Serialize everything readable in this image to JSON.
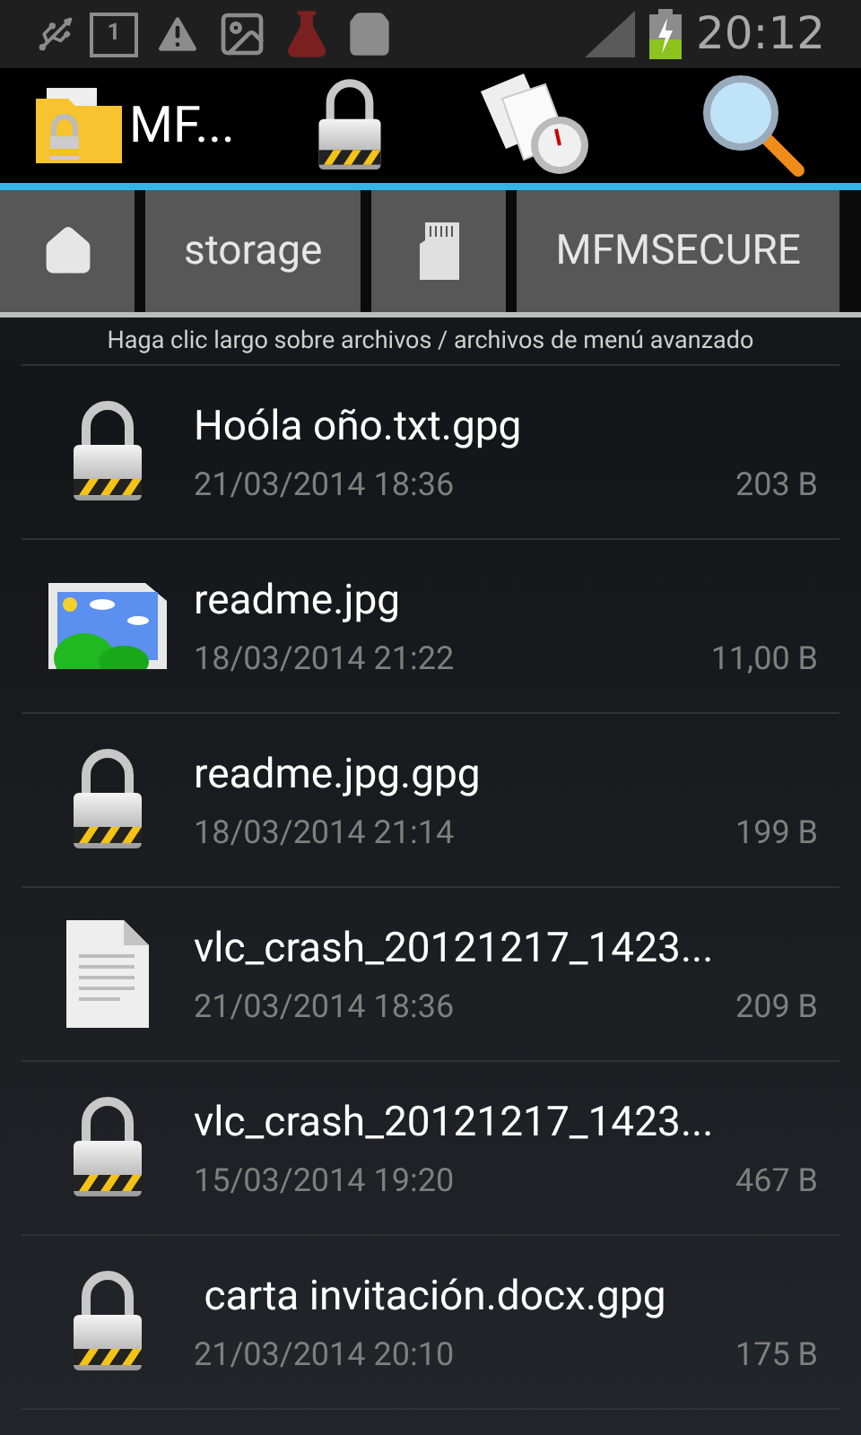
{
  "status_bar": {
    "time": "20:12",
    "calendar_day": "1"
  },
  "action_bar": {
    "title": "MF..."
  },
  "breadcrumbs": [
    {
      "kind": "home"
    },
    {
      "kind": "text",
      "label": "storage"
    },
    {
      "kind": "sdcard"
    },
    {
      "kind": "text",
      "label": "MFMSECURE"
    }
  ],
  "hint": "Haga clic largo sobre archivos / archivos de menú avanzado",
  "files": [
    {
      "kind": "locked",
      "name": "Hoóla oño.txt.gpg",
      "date": "21/03/2014 18:36",
      "size": "203 B"
    },
    {
      "kind": "image",
      "name": "readme.jpg",
      "date": "18/03/2014 21:22",
      "size": "11,00 B"
    },
    {
      "kind": "locked",
      "name": "readme.jpg.gpg",
      "date": "18/03/2014 21:14",
      "size": "199 B"
    },
    {
      "kind": "document",
      "name": "vlc_crash_20121217_1423...",
      "date": "21/03/2014 18:36",
      "size": "209 B"
    },
    {
      "kind": "locked",
      "name": "vlc_crash_20121217_1423...",
      "date": "15/03/2014 19:20",
      "size": "467 B"
    },
    {
      "kind": "locked",
      "name": " carta invitación.docx.gpg",
      "date": "21/03/2014 20:10",
      "size": "175 B"
    }
  ]
}
